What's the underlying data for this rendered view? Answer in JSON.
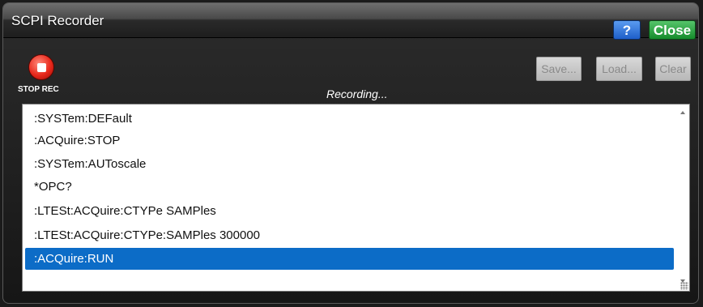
{
  "window": {
    "title": "SCPI Recorder",
    "help_label": "?",
    "close_label": "Close"
  },
  "toolbar": {
    "record_label": "STOP REC",
    "status": "Recording...",
    "save_label": "Save...",
    "load_label": "Load...",
    "clear_label": "Clear"
  },
  "commands": [
    ":SYSTem:DEFault",
    ":ACQuire:STOP",
    ":SYSTem:AUToscale",
    "*OPC?",
    ":LTESt:ACQuire:CTYPe SAMPles",
    ":LTESt:ACQuire:CTYPe:SAMPles 300000",
    ":ACQuire:RUN"
  ],
  "selected_command": ":ACQuire:RUN",
  "colors": {
    "selection": "#0c6cc7",
    "help_button": "#1e5fc9",
    "close_button": "#168b2c",
    "record_button": "#e8281b"
  },
  "icons": {
    "record": "stop-record-icon",
    "scroll_up": "scroll-up-icon",
    "scroll_down": "scroll-down-icon",
    "resize": "resize-grip-icon"
  }
}
